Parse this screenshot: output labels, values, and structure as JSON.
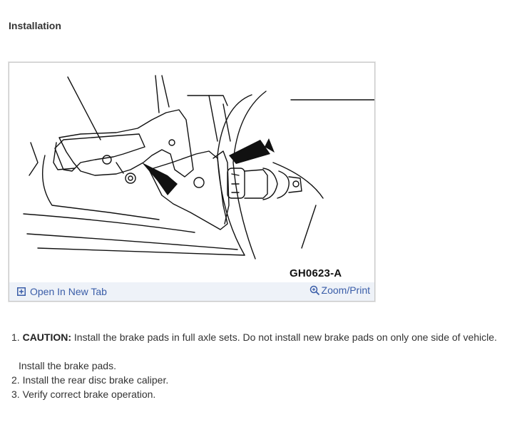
{
  "heading": "Installation",
  "figure": {
    "code": "GH0623-A",
    "open_label": "Open In New Tab",
    "zoom_label": "Zoom/Print",
    "icons": {
      "open": "open-new-tab-icon",
      "zoom": "zoom-icon"
    }
  },
  "steps": {
    "s1_number": "1.",
    "s1_caution": "CAUTION:",
    "s1_text": "Install the brake pads in full axle sets. Do not install new brake pads on only one side of vehicle.",
    "s1_sub": "Install the brake pads.",
    "s2": "2. Install the rear disc brake caliper.",
    "s3": "3. Verify correct brake operation."
  },
  "colors": {
    "link": "#3a5da8",
    "bar": "#eef2f8",
    "text": "#333333"
  }
}
